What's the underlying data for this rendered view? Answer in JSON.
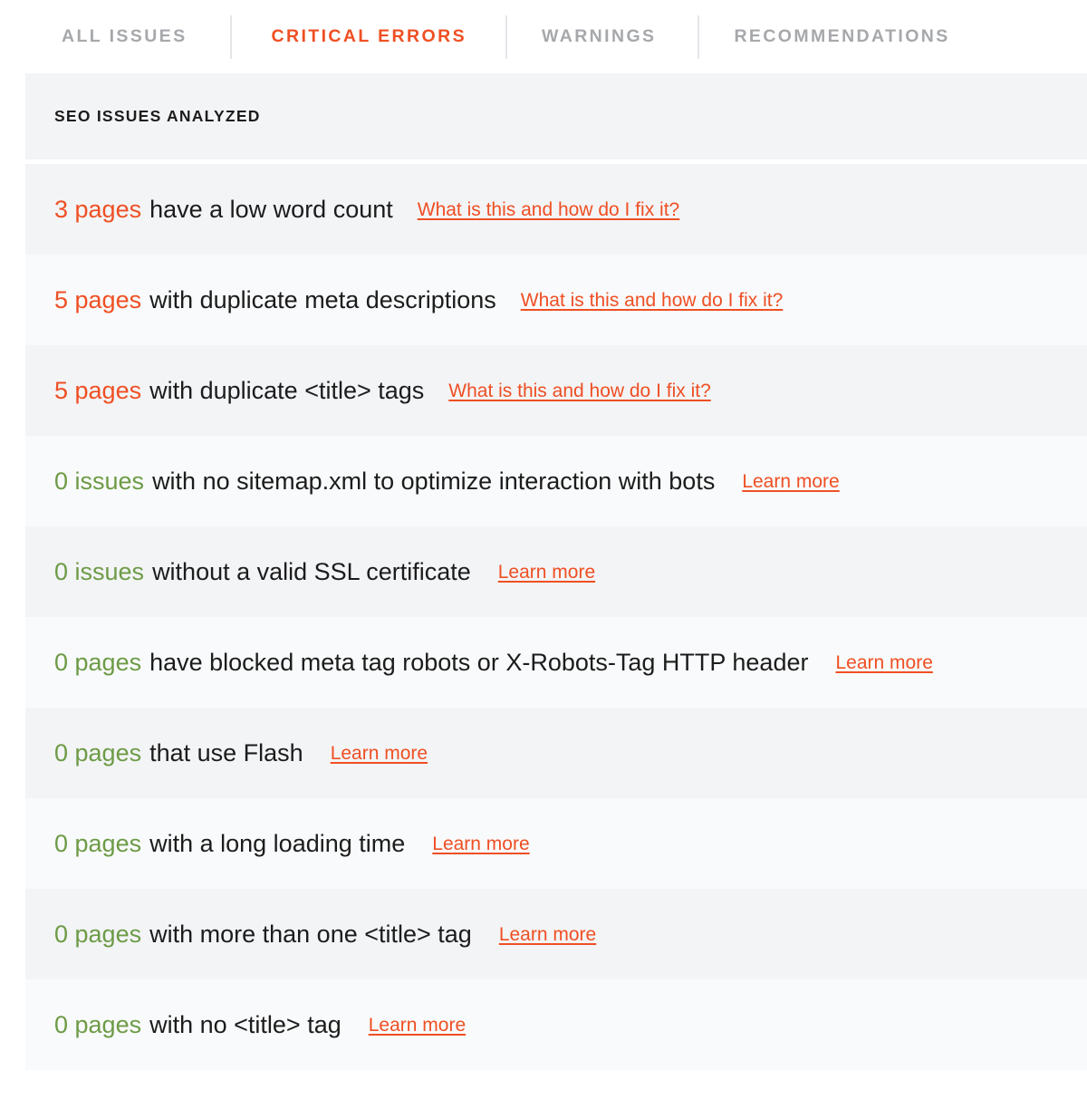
{
  "colors": {
    "accent_orange": "#ef4f23",
    "accent_green": "#6d9b46",
    "tab_inactive": "#a6a8ab",
    "row_shade_a": "#f3f4f6",
    "row_shade_b": "#f9fafb",
    "text_dark": "#1c1c1c"
  },
  "tabs": [
    {
      "label": "ALL ISSUES",
      "active": false
    },
    {
      "label": "CRITICAL ERRORS",
      "active": true
    },
    {
      "label": "WARNINGS",
      "active": false
    },
    {
      "label": "RECOMMENDATIONS",
      "active": false
    }
  ],
  "panel": {
    "header_title": "SEO ISSUES ANALYZED",
    "rows": [
      {
        "count": "3 pages",
        "severity": "bad",
        "text": "have a low word count",
        "link": "What is this and how do I fix it?"
      },
      {
        "count": "5 pages",
        "severity": "bad",
        "text": "with duplicate meta descriptions",
        "link": "What is this and how do I fix it?"
      },
      {
        "count": "5 pages",
        "severity": "bad",
        "text": "with duplicate <title> tags",
        "link": "What is this and how do I fix it?"
      },
      {
        "count": "0 issues",
        "severity": "good",
        "text": "with no sitemap.xml to optimize interaction with bots",
        "link": "Learn more"
      },
      {
        "count": "0 issues",
        "severity": "good",
        "text": "without a valid SSL certificate",
        "link": "Learn more"
      },
      {
        "count": "0 pages",
        "severity": "good",
        "text": "have blocked meta tag robots or X-Robots-Tag HTTP header",
        "link": "Learn more"
      },
      {
        "count": "0 pages",
        "severity": "good",
        "text": "that use Flash",
        "link": "Learn more"
      },
      {
        "count": "0 pages",
        "severity": "good",
        "text": "with a long loading time",
        "link": "Learn more"
      },
      {
        "count": "0 pages",
        "severity": "good",
        "text": "with more than one <title> tag",
        "link": "Learn more"
      },
      {
        "count": "0 pages",
        "severity": "good",
        "text": "with no <title> tag",
        "link": "Learn more"
      }
    ]
  }
}
